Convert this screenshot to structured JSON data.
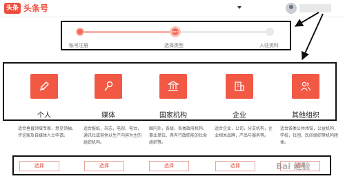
{
  "header": {
    "logo_badge": "头条",
    "logo_text": "头条号"
  },
  "progress": {
    "steps": [
      {
        "label": "账号注册",
        "status": "done"
      },
      {
        "label": "选择类型",
        "status": "current"
      },
      {
        "label": "入驻资料",
        "status": "pending"
      }
    ]
  },
  "categories": [
    {
      "name": "个人",
      "icon": "pen-icon",
      "desc": "适合垂直领域专家、意见领袖、评论家及自媒体人士申请。",
      "button": "选择"
    },
    {
      "name": "媒体",
      "icon": "microphone-icon",
      "desc": "适合报纸，杂志，电视，电台，通讯社或其他以生产内容为主的组织机构。",
      "button": "选择"
    },
    {
      "name": "国家机构",
      "icon": "building-icon",
      "desc": "国内外，各级、各类政府机构、事业单位、具有行政职能的社会组织等。",
      "button": "选择"
    },
    {
      "name": "企业",
      "icon": "company-icon",
      "desc": "适合企业，公司，分支机构，企业相关品牌，产品与服务等。",
      "button": "选择"
    },
    {
      "name": "其他组织",
      "icon": "people-icon",
      "desc": "适合各类公共场馆，公益机构，学校，社团，民间组织等机构团体。",
      "button": "选择"
    }
  ],
  "watermark": "Bai 经验",
  "colors": {
    "accent": "#ee4d3d",
    "icon_bg": "#f15945",
    "track_gray": "#e9e9ee"
  }
}
